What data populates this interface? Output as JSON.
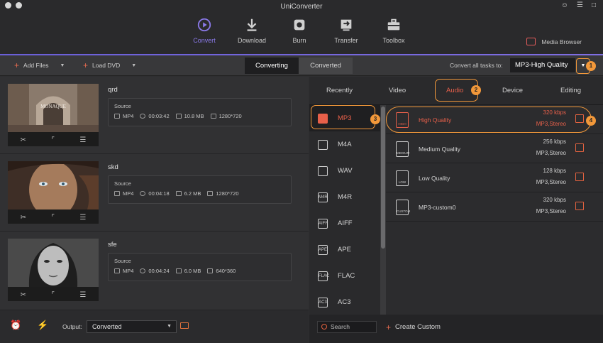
{
  "window": {
    "title": "UniConverter"
  },
  "nav": {
    "items": [
      {
        "label": "Convert",
        "icon": "convert-icon"
      },
      {
        "label": "Download",
        "icon": "download-icon"
      },
      {
        "label": "Burn",
        "icon": "burn-icon"
      },
      {
        "label": "Transfer",
        "icon": "transfer-icon"
      },
      {
        "label": "Toolbox",
        "icon": "toolbox-icon"
      }
    ],
    "active": "Convert",
    "media_browser": "Media Browser"
  },
  "toolbar": {
    "add_files": "Add Files",
    "load_dvd": "Load DVD",
    "tabs": [
      "Converting",
      "Converted"
    ],
    "active_tab": "Converting",
    "convert_all_label": "Convert all tasks to:",
    "convert_all_value": "MP3-High Quality"
  },
  "files": [
    {
      "name": "qrd",
      "source_label": "Source",
      "format": "MP4",
      "duration": "00:03:42",
      "size": "10.8 MB",
      "resolution": "1280*720"
    },
    {
      "name": "skd",
      "source_label": "Source",
      "format": "MP4",
      "duration": "00:04:18",
      "size": "6.2 MB",
      "resolution": "1280*720"
    },
    {
      "name": "sfe",
      "source_label": "Source",
      "format": "MP4",
      "duration": "00:04:24",
      "size": "6.0 MB",
      "resolution": "640*360"
    }
  ],
  "thumb_overlay_text": "MONAQUE",
  "bottom": {
    "output_label": "Output:",
    "output_value": "Converted"
  },
  "format_panel": {
    "tabs": [
      "Recently",
      "Video",
      "Audio",
      "Device",
      "Editing"
    ],
    "active_tab": "Audio",
    "formats": [
      "MP3",
      "M4A",
      "WAV",
      "M4R",
      "AIFF",
      "APE",
      "FLAC",
      "AC3"
    ],
    "format_icon_tags": [
      "",
      "",
      "",
      "M4R",
      "AIFF",
      "APE",
      "FLAC",
      "AC3"
    ],
    "selected_format": "MP3",
    "qualities": [
      {
        "name": "High Quality",
        "rate": "320 kbps",
        "meta": "MP3,Stereo",
        "tag": "HIGH"
      },
      {
        "name": "Medium Quality",
        "rate": "256 kbps",
        "meta": "MP3,Stereo",
        "tag": "MEDIUM"
      },
      {
        "name": "Low Quality",
        "rate": "128 kbps",
        "meta": "MP3,Stereo",
        "tag": "LOW"
      },
      {
        "name": "MP3-custom0",
        "rate": "320 kbps",
        "meta": "MP3,Stereo",
        "tag": "CUSTOM"
      }
    ],
    "selected_quality": "High Quality",
    "search_placeholder": "Search",
    "create_custom": "Create Custom"
  },
  "callouts": [
    "1",
    "2",
    "3",
    "4"
  ],
  "colors": {
    "accent": "#8a79e8",
    "highlight": "#e8604a",
    "callout": "#f2983a"
  }
}
